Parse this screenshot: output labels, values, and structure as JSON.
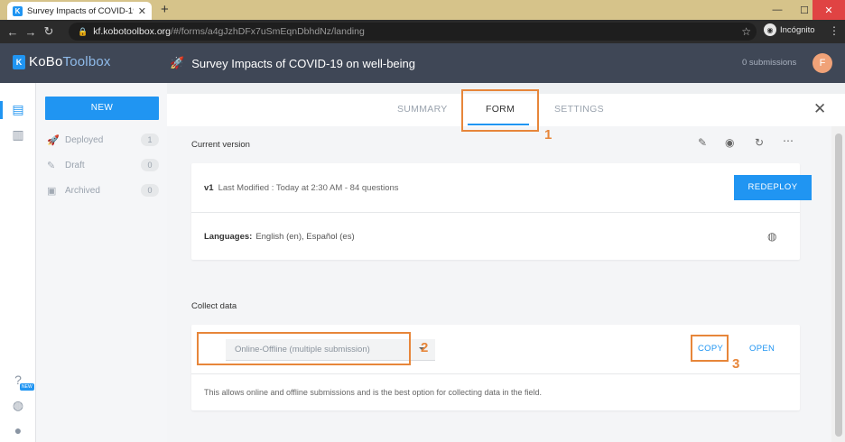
{
  "browser": {
    "tab_title": "Survey Impacts of COVID-19 on w",
    "tab_favicon": "K",
    "new_tab": "+",
    "url_host": "kf.kobotoolbox.org",
    "url_path": "/#/forms/a4gJzhDFx7uSmEqnDbhdNz/landing",
    "profile_label": "Incógnito",
    "window_min": "—",
    "window_max": "☐",
    "window_close": "✕"
  },
  "header": {
    "logo_bold": "KoBo",
    "logo_thin": "Toolbox",
    "survey_title": "Survey Impacts of COVID-19 on well-being",
    "submissions": "0 submissions",
    "avatar_initial": "F"
  },
  "sidebar": {
    "new_label": "NEW",
    "items": [
      {
        "label": "Deployed",
        "count": "1"
      },
      {
        "label": "Draft",
        "count": "0"
      },
      {
        "label": "Archived",
        "count": "0"
      }
    ]
  },
  "rail": {
    "new_badge": "NEW"
  },
  "tabs": [
    {
      "label": "SUMMARY"
    },
    {
      "label": "FORM"
    },
    {
      "label": "SETTINGS"
    }
  ],
  "form": {
    "current_version_label": "Current version",
    "version": "v1",
    "modified": "Last Modified : Today at 2:30 AM - 84 questions",
    "redeploy_label": "REDEPLOY",
    "languages_label": "Languages:",
    "languages_value": "English (en), Español (es)",
    "collect_label": "Collect data",
    "collect_method": "Online-Offline (multiple submission)",
    "copy_label": "COPY",
    "open_label": "OPEN",
    "description": "This allows online and offline submissions and is the best option for collecting data in the field."
  },
  "annotations": [
    "1",
    "2",
    "3"
  ],
  "colors": {
    "accent": "#2095f2",
    "header": "#3f4756",
    "highlight": "#e7863a"
  }
}
